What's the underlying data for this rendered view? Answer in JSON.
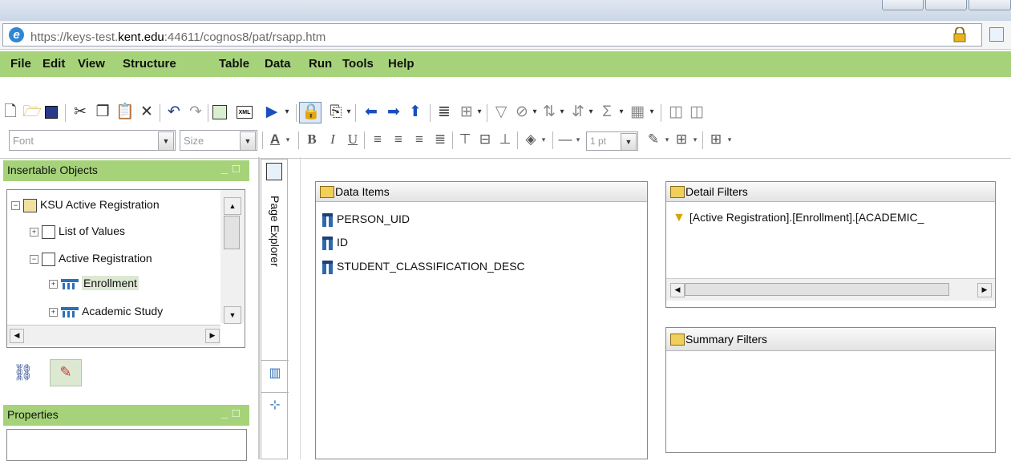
{
  "browser": {
    "url_prefix": "https://",
    "url_host_pre": "keys-test.",
    "url_host_main": "kent.edu",
    "url_rest": ":44611/cognos8/pat/rsapp.htm",
    "ie_icon": "ie-icon",
    "lock_icon": "lock-icon"
  },
  "menubar": {
    "items": [
      "File",
      "Edit",
      "View",
      "Structure",
      "Table",
      "Data",
      "Run",
      "Tools",
      "Help"
    ]
  },
  "format_toolbar": {
    "font_placeholder": "Font",
    "size_placeholder": "Size",
    "line_weight": "1 pt"
  },
  "insertable_objects": {
    "title": "Insertable Objects",
    "tree": [
      {
        "label": "KSU Active Registration",
        "expander": "−"
      },
      {
        "label": "List of Values",
        "expander": "+"
      },
      {
        "label": "Active Registration",
        "expander": "−"
      },
      {
        "label": "Enrollment",
        "expander": "+"
      },
      {
        "label": "Academic Study",
        "expander": "+"
      }
    ]
  },
  "properties": {
    "title": "Properties"
  },
  "explorer_bar": {
    "page_explorer_label": "Page Explorer"
  },
  "data_items": {
    "title": "Data Items",
    "items": [
      "PERSON_UID",
      "ID",
      "STUDENT_CLASSIFICATION_DESC"
    ]
  },
  "detail_filters": {
    "title": "Detail Filters",
    "items": [
      "[Active Registration].[Enrollment].[ACADEMIC_"
    ]
  },
  "summary_filters": {
    "title": "Summary Filters"
  },
  "colors": {
    "accent_green": "#a6d37a",
    "selected_item_bg": "#dde8d3"
  }
}
